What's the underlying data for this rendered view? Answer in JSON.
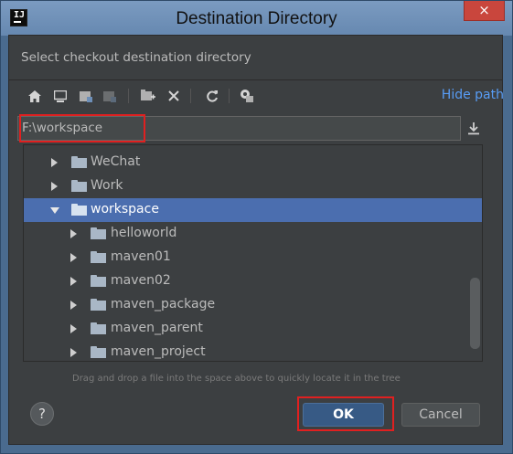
{
  "window": {
    "title": "Destination Directory",
    "app_icon_text": "IJ",
    "close_glyph": "×"
  },
  "description": "Select checkout destination directory",
  "toolbar": {
    "icons": [
      "home-icon",
      "desktop-icon",
      "project-icon",
      "module-icon",
      "new-folder-icon",
      "delete-icon",
      "refresh-icon",
      "show-hidden-icon"
    ],
    "hide_path_label": "Hide path"
  },
  "path": {
    "value": "F:\\workspace"
  },
  "tree": {
    "items": [
      {
        "label": "WeChat",
        "expanded": false,
        "selected": false,
        "level": 0
      },
      {
        "label": "Work",
        "expanded": false,
        "selected": false,
        "level": 0
      },
      {
        "label": "workspace",
        "expanded": true,
        "selected": true,
        "level": 0
      },
      {
        "label": "helloworld",
        "expanded": false,
        "selected": false,
        "level": 1
      },
      {
        "label": "maven01",
        "expanded": false,
        "selected": false,
        "level": 1
      },
      {
        "label": "maven02",
        "expanded": false,
        "selected": false,
        "level": 1
      },
      {
        "label": "maven_package",
        "expanded": false,
        "selected": false,
        "level": 1
      },
      {
        "label": "maven_parent",
        "expanded": false,
        "selected": false,
        "level": 1
      },
      {
        "label": "maven_project",
        "expanded": false,
        "selected": false,
        "level": 1
      }
    ]
  },
  "hint": "Drag and drop a file into the space above to quickly locate it in the tree",
  "buttons": {
    "help": "?",
    "ok": "OK",
    "cancel": "Cancel"
  },
  "colors": {
    "selection": "#4b6eaf",
    "link": "#589df6",
    "highlight_box": "#e02020",
    "ok_button": "#375a85"
  }
}
